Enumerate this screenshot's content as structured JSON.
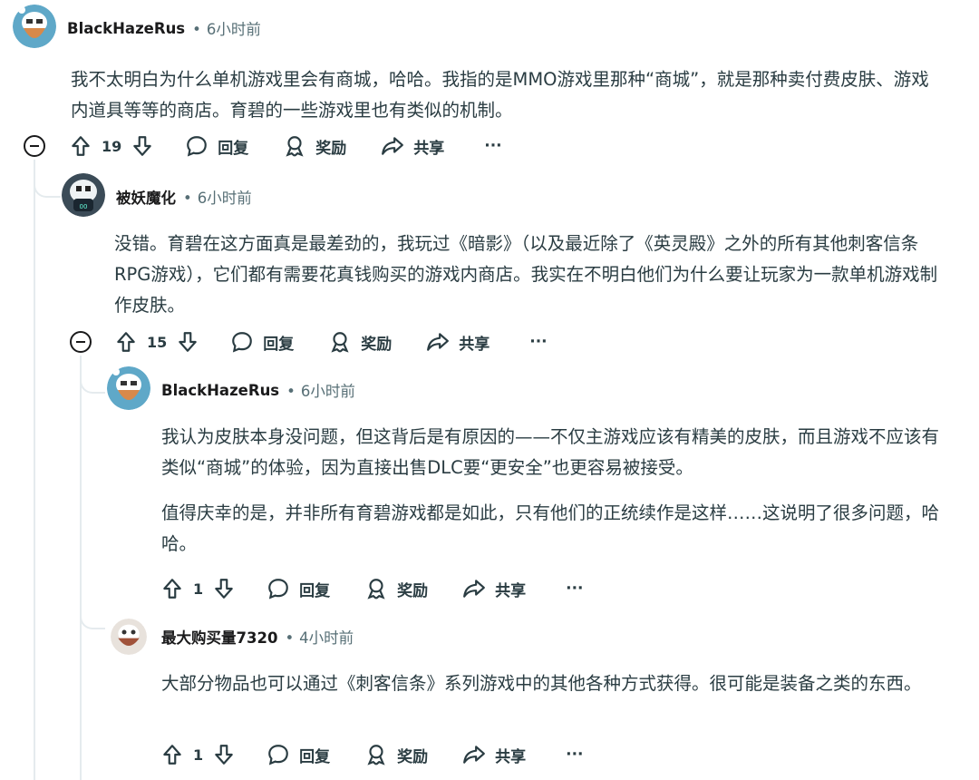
{
  "comments": [
    {
      "author": "BlackHazeRus",
      "time": "6小时前",
      "body": [
        "我不太明白为什么单机游戏里会有商城，哈哈。我指的是MMO游戏里那种“商城”，就是那种卖付费皮肤、游戏内道具等等的商店。育碧的一些游戏里也有类似的机制。"
      ],
      "votes": "19"
    },
    {
      "author": "被妖魔化",
      "time": "6小时前",
      "body": [
        "没错。育碧在这方面真是最差劲的，我玩过《暗影》（以及最近除了《英灵殿》之外的所有其他刺客信条RPG游戏），它们都有需要花真钱购买的游戏内商店。我实在不明白他们为什么要让玩家为一款单机游戏制作皮肤。"
      ],
      "votes": "15"
    },
    {
      "author": "BlackHazeRus",
      "time": "6小时前",
      "body": [
        "我认为皮肤本身没问题，但这背后是有原因的——不仅主游戏应该有精美的皮肤，而且游戏不应该有类似“商城”的体验，因为直接出售DLC要“更安全”也更容易被接受。",
        "值得庆幸的是，并非所有育碧游戏都是如此，只有他们的正统续作是这样……这说明了很多问题，哈哈。"
      ],
      "votes": "1"
    },
    {
      "author": "最大购买量7320",
      "time": "4小时前",
      "body": [
        "大部分物品也可以通过《刺客信条》系列游戏中的其他各种方式获得。很可能是装备之类的东西。"
      ],
      "votes": "1"
    }
  ],
  "actions": {
    "reply": "回复",
    "award": "奖励",
    "share": "共享",
    "more": "···"
  },
  "icons": [
    "upvote-icon",
    "downvote-icon",
    "reply-icon",
    "award-icon",
    "share-icon",
    "collapse-icon"
  ],
  "colors": {
    "text": "#1a1a1b",
    "meta": "#576f76",
    "line": "#e5ebee"
  }
}
